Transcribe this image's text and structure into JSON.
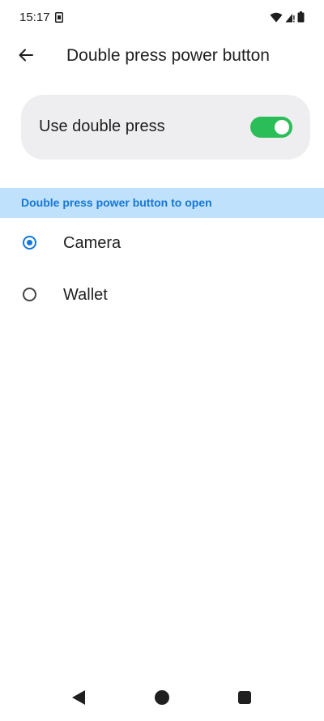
{
  "status_bar": {
    "time": "15:17",
    "icons": [
      "sim-card-icon",
      "wifi-icon",
      "signal-icon",
      "battery-icon"
    ]
  },
  "app_bar": {
    "title": "Double press power button",
    "back_icon": "back-arrow-icon"
  },
  "main_toggle": {
    "label": "Use double press",
    "enabled": true,
    "accent_color": "#2bbd58"
  },
  "section": {
    "header": "Double press power button to open",
    "header_color": "#1477d6",
    "header_bg": "#bfe1fb"
  },
  "options": [
    {
      "label": "Camera",
      "selected": true
    },
    {
      "label": "Wallet",
      "selected": false
    }
  ],
  "nav_bar": {
    "icons": [
      "nav-back-icon",
      "nav-home-icon",
      "nav-recents-icon"
    ]
  }
}
